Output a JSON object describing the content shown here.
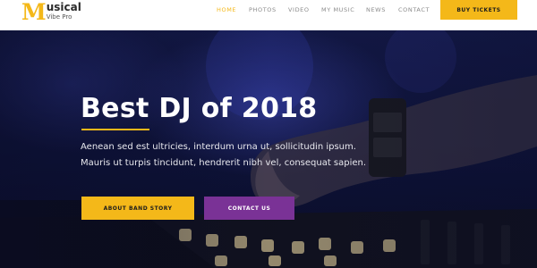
{
  "logo": {
    "letter": "M",
    "title": "usical",
    "subtitle": "Vibe Pro"
  },
  "nav": {
    "items": [
      {
        "label": "HOME",
        "active": true
      },
      {
        "label": "PHOTOS",
        "active": false
      },
      {
        "label": "VIDEO",
        "active": false
      },
      {
        "label": "MY MUSIC",
        "active": false
      },
      {
        "label": "NEWS",
        "active": false
      },
      {
        "label": "CONTACT",
        "active": false
      }
    ],
    "cta_label": "BUY TICKETS"
  },
  "hero": {
    "title": "Best DJ of 2018",
    "description": "Aenean sed est ultricies, interdum urna ut, sollicitudin ipsum. Mauris ut turpis tincidunt, hendrerit nibh vel, consequat sapien.",
    "primary_button": "ABOUT BAND STORY",
    "secondary_button": "CONTACT US"
  },
  "colors": {
    "accent": "#f4b819",
    "secondary": "#7a3296",
    "hero_overlay": "#141a4a"
  }
}
